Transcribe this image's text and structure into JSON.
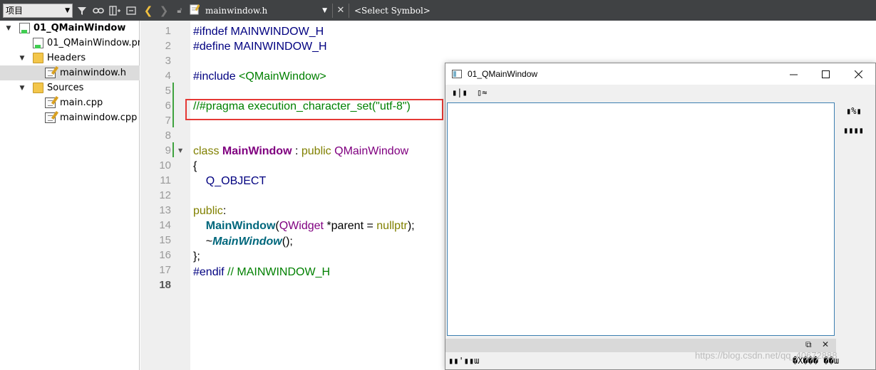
{
  "project_panel": {
    "combo_label": "项目",
    "tree": [
      {
        "label": "01_QMainWindow",
        "type": "project",
        "expanded": true
      },
      {
        "label": "01_QMainWindow.pro",
        "type": "pro-file"
      },
      {
        "label": "Headers",
        "type": "folder",
        "expanded": true
      },
      {
        "label": "mainwindow.h",
        "type": "header",
        "selected": true
      },
      {
        "label": "Sources",
        "type": "folder",
        "expanded": true
      },
      {
        "label": "main.cpp",
        "type": "source"
      },
      {
        "label": "mainwindow.cpp",
        "type": "source"
      }
    ]
  },
  "editor_toolbar": {
    "file_name": "mainwindow.h",
    "symbol": "<Select Symbol>"
  },
  "editor": {
    "line_numbers": [
      "1",
      "2",
      "3",
      "4",
      "5",
      "6",
      "7",
      "8",
      "9",
      "10",
      "11",
      "12",
      "13",
      "14",
      "15",
      "16",
      "17",
      "18"
    ],
    "current_line": "18",
    "code": {
      "l1": "#ifndef MAINWINDOW_H",
      "l2": "#define MAINWINDOW_H",
      "l4a": "#include ",
      "l4b": "<QMainWindow>",
      "l6": "//#pragma execution_character_set(\"utf-8\")",
      "l9a": "class ",
      "l9b": "MainWindow",
      "l9c": " : ",
      "l9d": "public ",
      "l9e": "QMainWindow",
      "l10": "{",
      "l11": "    Q_OBJECT",
      "l13a": "public",
      "l13b": ":",
      "l14a": "    ",
      "l14b": "MainWindow",
      "l14c": "(",
      "l14d": "QWidget",
      "l14e": " *parent = ",
      "l14f": "nullptr",
      "l14g": ");",
      "l15a": "    ~",
      "l15b": "MainWindow",
      "l15c": "();",
      "l16": "};",
      "l17a": "#endif ",
      "l17b": "// MAINWINDOW_H"
    }
  },
  "app_window": {
    "title": "01_QMainWindow",
    "toolbar_items": [
      "▮|▮",
      "▯≈"
    ],
    "side_items": [
      "▮%▮",
      "▮▮▮▮"
    ],
    "status_left": "▮▮'▮▮ɯ",
    "status_right": "�X��� ��ɯ",
    "watermark": "https://blog.csdn.net/qq_40672888"
  }
}
